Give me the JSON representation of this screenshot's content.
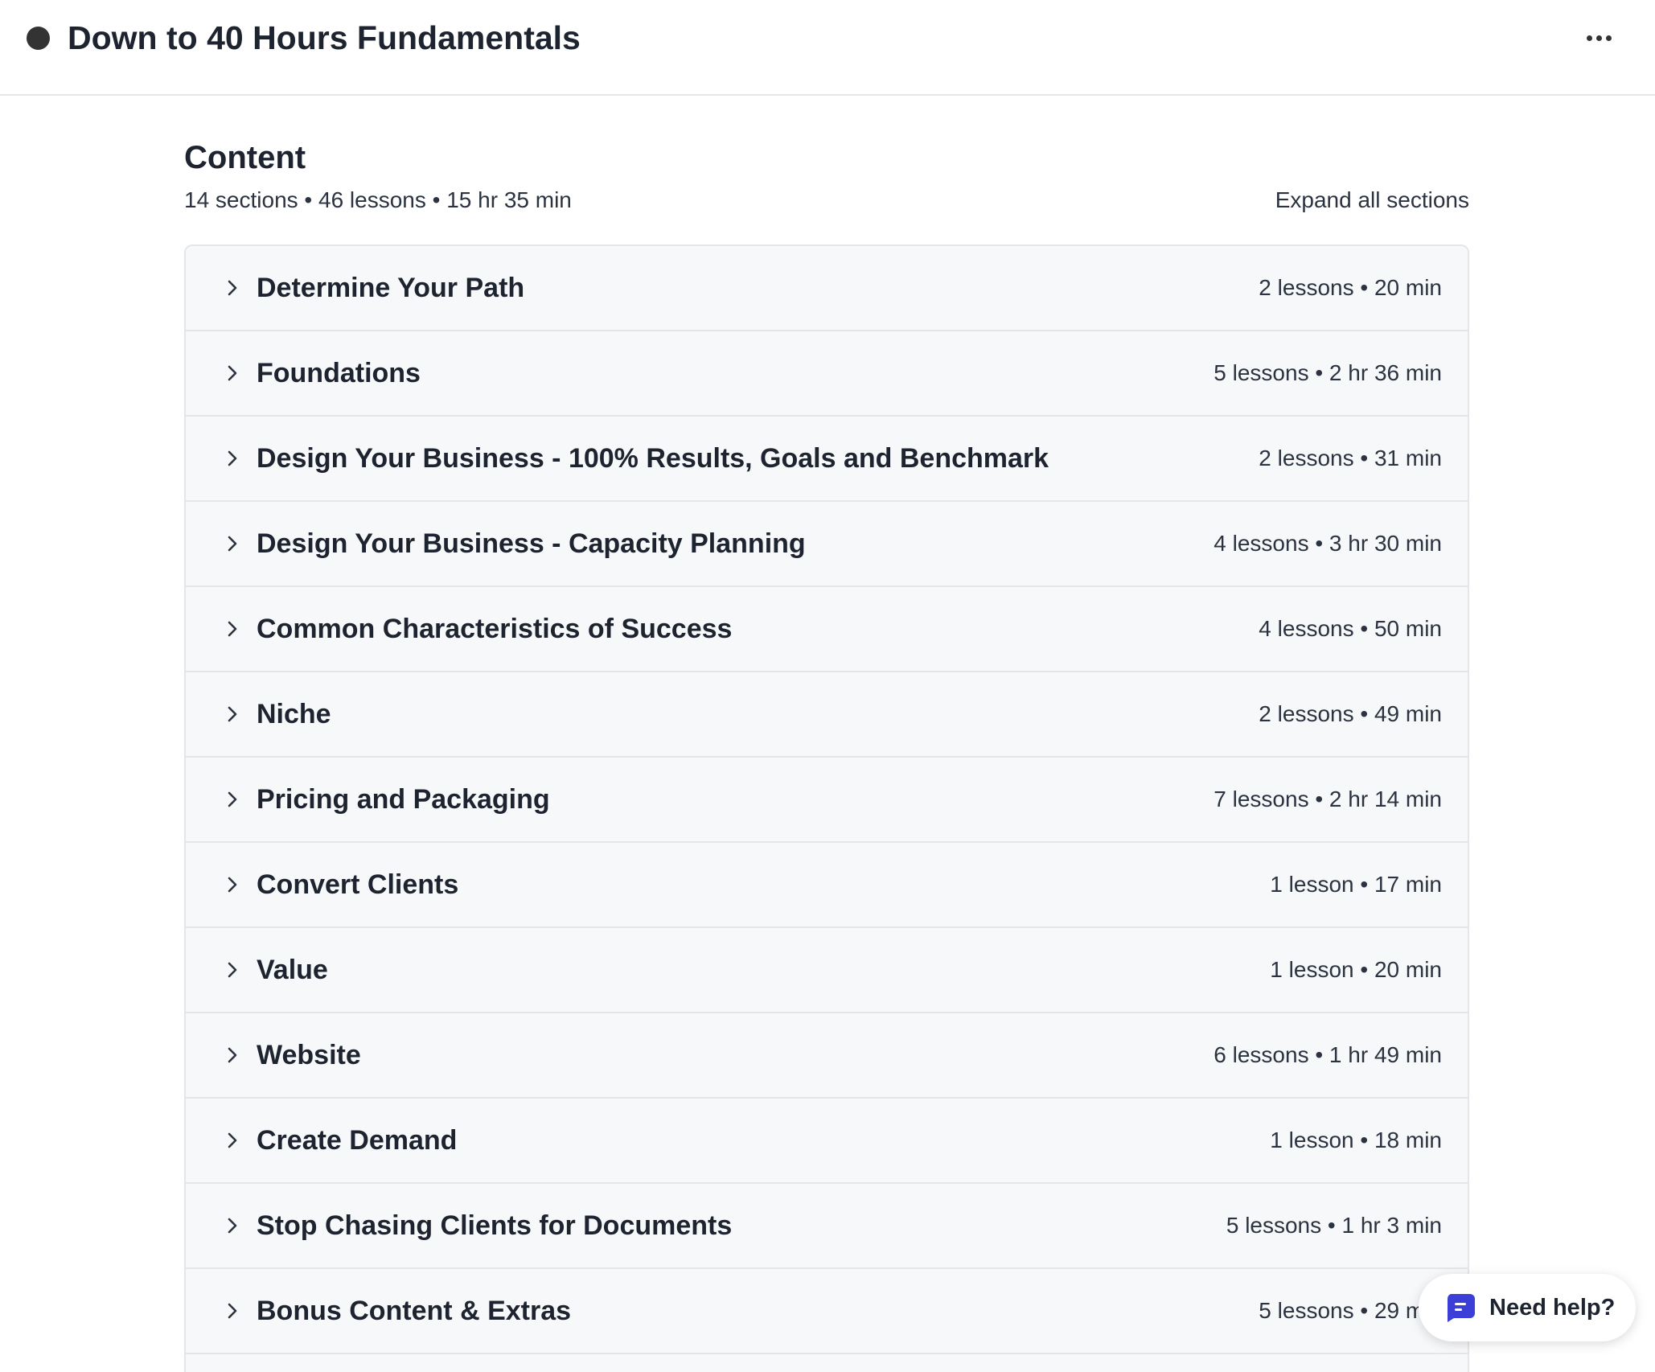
{
  "header": {
    "course_title": "Down to 40 Hours Fundamentals",
    "more_icon": "more-horizontal-icon"
  },
  "content": {
    "title": "Content",
    "stats": "14 sections • 46 lessons • 15 hr 35 min",
    "expand_all_label": "Expand all sections"
  },
  "sections": [
    {
      "title": "Determine Your Path",
      "meta": "2 lessons • 20 min"
    },
    {
      "title": "Foundations",
      "meta": "5 lessons • 2 hr 36 min"
    },
    {
      "title": "Design Your Business - 100% Results, Goals and Benchmark",
      "meta": "2 lessons • 31 min"
    },
    {
      "title": "Design Your Business - Capacity Planning",
      "meta": "4 lessons • 3 hr 30 min"
    },
    {
      "title": "Common Characteristics of Success",
      "meta": "4 lessons • 50 min"
    },
    {
      "title": "Niche",
      "meta": "2 lessons • 49 min"
    },
    {
      "title": "Pricing and Packaging",
      "meta": "7 lessons • 2 hr 14 min"
    },
    {
      "title": "Convert Clients",
      "meta": "1 lesson • 17 min"
    },
    {
      "title": "Value",
      "meta": "1 lesson • 20 min"
    },
    {
      "title": "Website",
      "meta": "6 lessons • 1 hr 49 min"
    },
    {
      "title": "Create Demand",
      "meta": "1 lesson • 18 min"
    },
    {
      "title": "Stop Chasing Clients for Documents",
      "meta": "5 lessons • 1 hr 3 min"
    },
    {
      "title": "Bonus Content & Extras",
      "meta": "5 lessons • 29 min"
    },
    {
      "title": "",
      "meta": ""
    }
  ],
  "help": {
    "label": "Need help?",
    "icon": "chat-icon",
    "accent_color": "#3b3fd8"
  }
}
